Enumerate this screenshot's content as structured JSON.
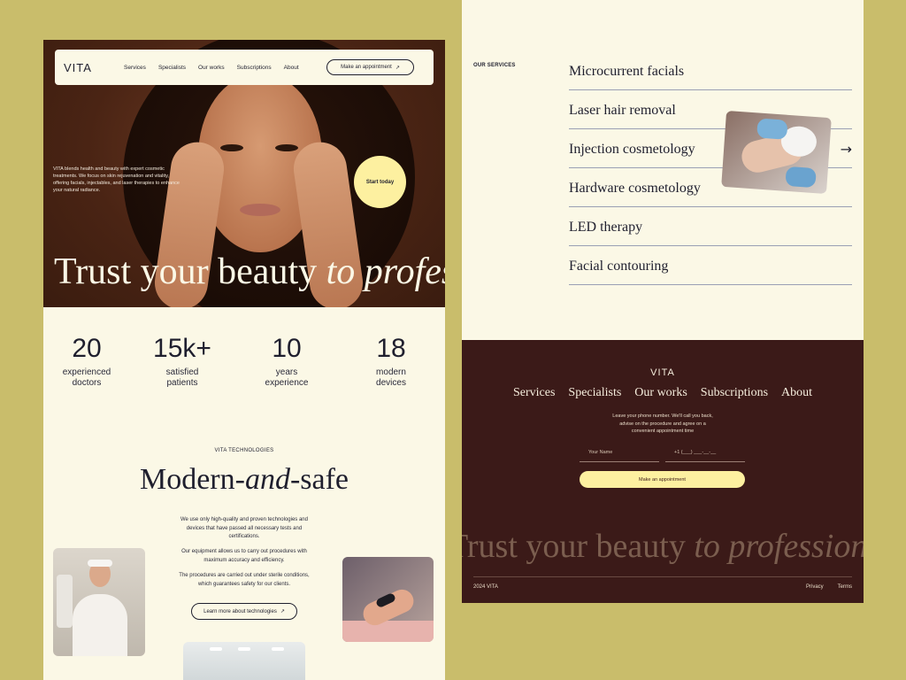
{
  "colors": {
    "background": "#c9bd6b",
    "cream": "#fbf8e6",
    "accent_yellow": "#fdf0a0",
    "dark_brown": "#3b1a18",
    "ink": "#1f1f2e"
  },
  "left": {
    "nav": {
      "logo": "VITA",
      "links": [
        "Services",
        "Specialists",
        "Our works",
        "Subscriptions",
        "About"
      ],
      "cta": "Make an appointment",
      "cta_icon": "arrow-up-right-icon"
    },
    "hero": {
      "intro": "VITA blends health and beauty with expert cosmetic treatments. We focus on skin rejuvenation and vitality, offering facials, injectables, and laser therapies to enhance your natural radiance.",
      "start_button": "Start today",
      "headline_main": "Trust your beauty",
      "headline_italic": "to professionals"
    },
    "stats": [
      {
        "value": "20",
        "label_1": "experienced",
        "label_2": "doctors"
      },
      {
        "value": "15k+",
        "label_1": "satisfied",
        "label_2": "patients"
      },
      {
        "value": "10",
        "label_1": "years",
        "label_2": "experience"
      },
      {
        "value": "18",
        "label_1": "modern",
        "label_2": "devices"
      }
    ],
    "technologies": {
      "eyebrow": "VITA TECHNOLOGIES",
      "title_a": "Modern-",
      "title_b": "and",
      "title_c": "-safe",
      "para_1": "We use only high-quality and proven technologies and devices that have passed all necessary tests and certifications.",
      "para_2": "Our equipment allows us to carry out procedures with maximum accuracy and efficiency.",
      "para_3": "The procedures are carried out under sterile conditions, which guarantees safety for our clients.",
      "learn_button": "Learn more about technologies"
    }
  },
  "right": {
    "services": {
      "eyebrow": "OUR SERVICES",
      "items": [
        "Microcurrent facials",
        "Laser hair removal",
        "Injection cosmetology",
        "Hardware cosmetology",
        "LED therapy",
        "Facial contouring"
      ]
    },
    "footer": {
      "logo": "VITA",
      "nav": [
        "Services",
        "Specialists",
        "Our works",
        "Subscriptions",
        "About"
      ],
      "note": "Leave your phone number. We'll call you back, advise on the procedure and agree on a convenient appointment time",
      "name_placeholder": "Your Name",
      "phone_placeholder": "+1 (___) ___-__-__",
      "submit": "Make an appointment",
      "headline_main": "Trust your beauty",
      "headline_italic": "to professionals",
      "copyright": "2024 VITA",
      "privacy": "Privacy",
      "terms": "Terms"
    }
  }
}
